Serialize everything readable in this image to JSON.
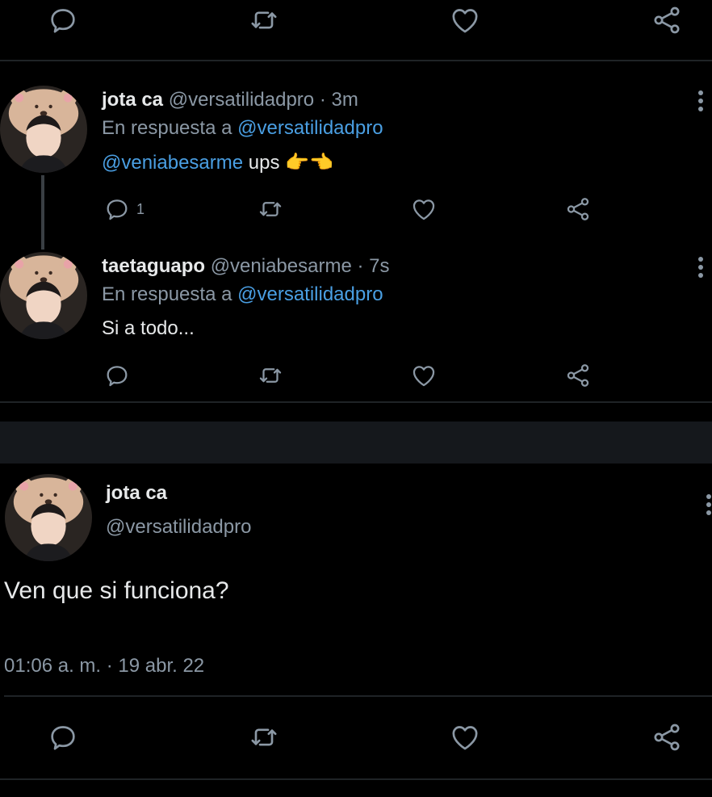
{
  "top_actions": {
    "icons": [
      "reply-icon",
      "retweet-icon",
      "like-icon",
      "share-icon"
    ]
  },
  "reply1": {
    "name": "jota ca",
    "handle": "@versatilidadpro",
    "time": "· 3m",
    "replying_prefix": "En respuesta a",
    "replying_to": "@versatilidadpro",
    "mention": "@veniabesarme",
    "text": "ups 👉👈",
    "reply_count": "1"
  },
  "reply2": {
    "name": "taetaguapo",
    "handle": "@veniabesarme",
    "time": "· 7s",
    "replying_prefix": "En respuesta a",
    "replying_to": "@versatilidadpro",
    "text": "Si a todo..."
  },
  "main_tweet": {
    "name": "jota ca",
    "handle": "@versatilidadpro",
    "text": "Ven que si funciona?",
    "timestamp": "01:06 a. m. · 19 abr. 22"
  },
  "colors": {
    "background": "#000000",
    "text": "#e7e9ea",
    "muted": "#8b98a5",
    "link": "#4a9fe3",
    "divider": "#1f2326"
  }
}
